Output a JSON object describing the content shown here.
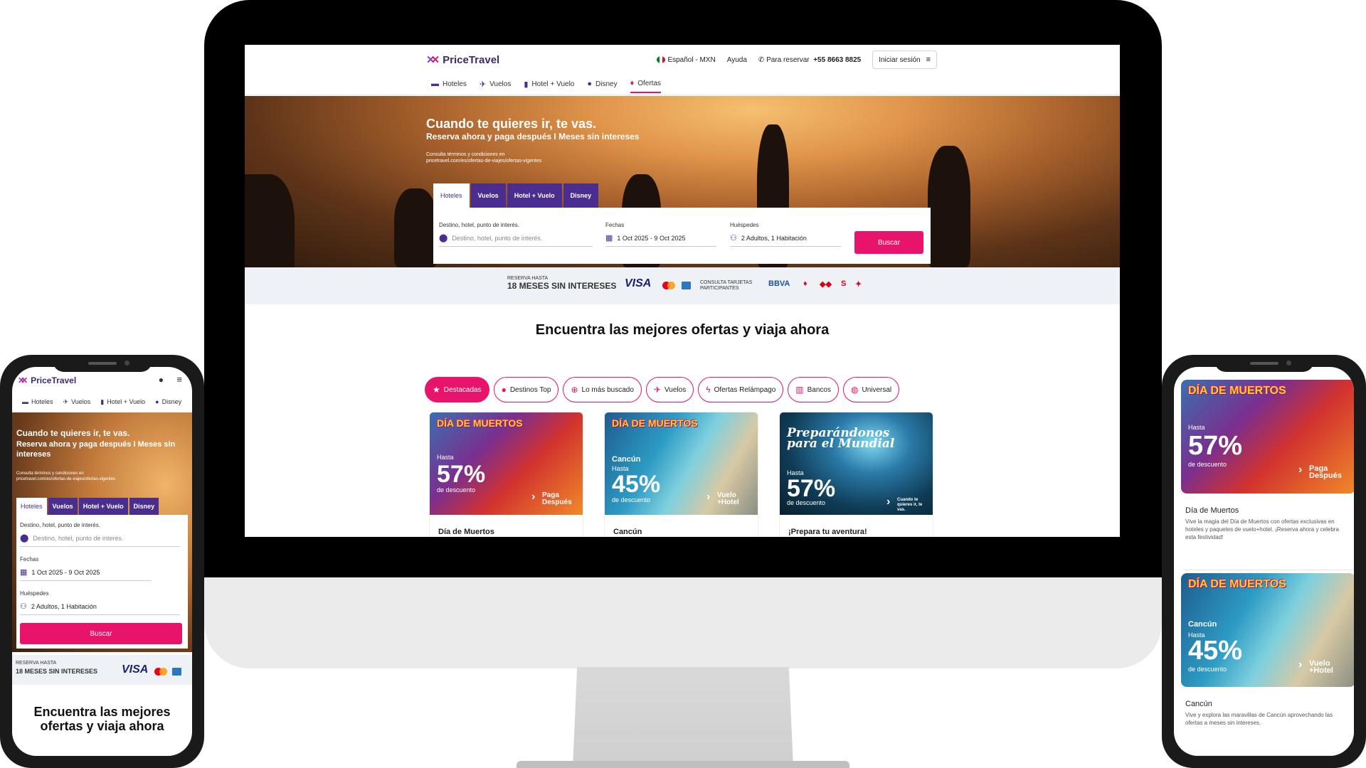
{
  "brand": {
    "name": "PriceTravel",
    "primary": "#4b2d8f",
    "accent": "#e8146c"
  },
  "header": {
    "language": "Español - MXN",
    "help": "Ayuda",
    "phone_label": "Para reservar",
    "phone_number": "+55 8663 8825",
    "login": "Iniciar sesión"
  },
  "nav": [
    {
      "label": "Hoteles",
      "icon": "bed-icon"
    },
    {
      "label": "Vuelos",
      "icon": "plane-icon"
    },
    {
      "label": "Hotel + Vuelo",
      "icon": "luggage-icon"
    },
    {
      "label": "Disney",
      "icon": "mickey-icon"
    },
    {
      "label": "Ofertas",
      "icon": "flame-icon",
      "active": true
    }
  ],
  "hero": {
    "title": "Cuando te quieres ir, te vas.",
    "subtitle": "Reserva ahora y paga después I Meses sin intereses",
    "terms_line1": "Consulta términos y condiciones en",
    "terms_line2": "pricetravel.com/es/ofertas-de-viajes/ofertas-vigentes"
  },
  "search": {
    "tabs": [
      "Hoteles",
      "Vuelos",
      "Hotel + Vuelo",
      "Disney"
    ],
    "destination_label": "Destino, hotel, punto de interés.",
    "destination_placeholder": "Destino, hotel, punto de interés.",
    "dates_label": "Fechas",
    "dates_value": "1 Oct 2025 - 9 Oct 2025",
    "guests_label": "Huéspedes",
    "guests_value": "2 Adultos, 1 Habitación",
    "button": "Buscar"
  },
  "promo": {
    "small": "RESERVA HASTA",
    "big": "18 MESES SIN INTERESES",
    "visa": "VISA",
    "consult_line1": "CONSULTA TARJETAS",
    "consult_line2": "PARTICIPANTES",
    "bank1": "BBVA"
  },
  "offers": {
    "heading": "Encuentra las mejores ofertas y viaja ahora",
    "mobile_heading": "Encuentra las mejores ofertas y viaja ahora",
    "chips": [
      {
        "label": "Destacadas",
        "icon": "star-icon",
        "active": true
      },
      {
        "label": "Destinos Top",
        "icon": "map-pin-icon"
      },
      {
        "label": "Lo más buscado",
        "icon": "search-icon"
      },
      {
        "label": "Vuelos",
        "icon": "plane-icon"
      },
      {
        "label": "Ofertas Relámpago",
        "icon": "lightning-icon"
      },
      {
        "label": "Bancos",
        "icon": "bank-icon"
      },
      {
        "label": "Universal",
        "icon": "globe-icon"
      }
    ],
    "cards": [
      {
        "title": "Día de Muertos",
        "badge": "DÍA DE MUERTOS",
        "prefix": "Hasta",
        "discount": "57%",
        "discount_label": "de descuento",
        "cta": "Paga Después",
        "desc": "Vive la magia del Día de Muertos con ofertas exclusivas en hoteles y paquetes de vuelo+hotel. ¡Reserva ahora y celebra esta festividad!"
      },
      {
        "title": "Cancún",
        "badge": "DÍA DE MUERTOS",
        "city": "Cancún",
        "prefix": "Hasta",
        "discount": "45%",
        "discount_label": "de descuento",
        "cta": "Vuelo +Hotel",
        "desc": "Vive y explora las maravillas de Cancún aprovechando las ofertas a meses sin intereses."
      },
      {
        "title": "¡Prepara tu aventura!",
        "badge": "Preparándonos para el Mundial",
        "prefix": "Hasta",
        "discount": "57%",
        "discount_label": "de descuento",
        "cta": "Cuando te quieres ir, te vas."
      }
    ]
  }
}
